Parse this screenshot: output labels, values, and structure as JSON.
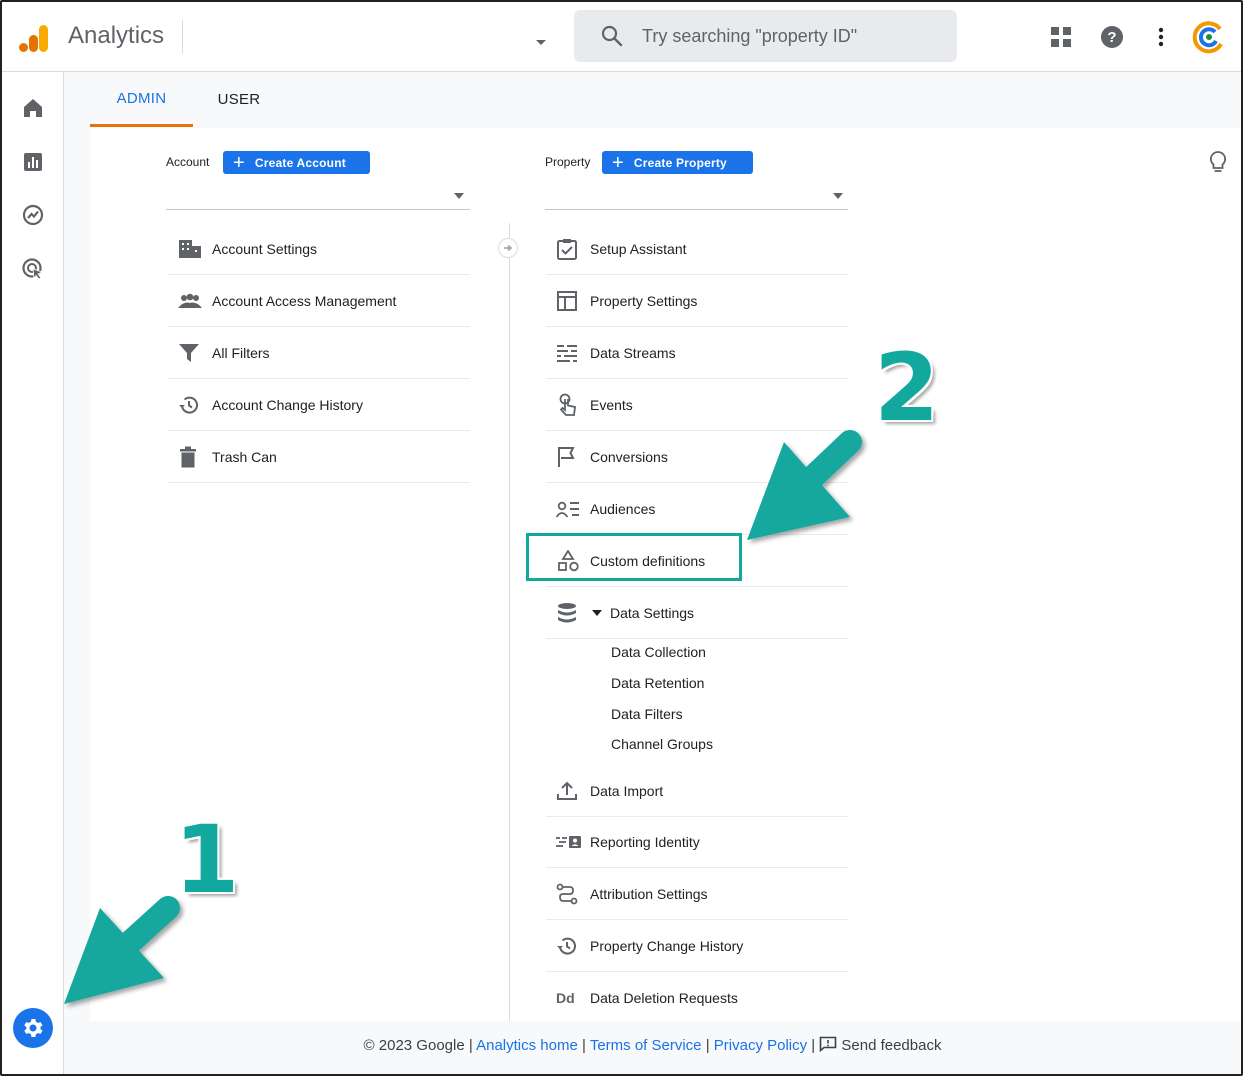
{
  "header": {
    "app_title": "Analytics",
    "search_placeholder": "Try searching \"property ID\""
  },
  "tabs": [
    {
      "label": "ADMIN",
      "active": true
    },
    {
      "label": "USER",
      "active": false
    }
  ],
  "account": {
    "label": "Account",
    "create_label": "Create Account",
    "items": [
      {
        "label": "Account Settings",
        "icon": "building-icon"
      },
      {
        "label": "Account Access Management",
        "icon": "people-icon"
      },
      {
        "label": "All Filters",
        "icon": "filter-icon"
      },
      {
        "label": "Account Change History",
        "icon": "history-icon"
      },
      {
        "label": "Trash Can",
        "icon": "trash-icon"
      }
    ]
  },
  "property": {
    "label": "Property",
    "create_label": "Create Property",
    "items": [
      {
        "label": "Setup Assistant",
        "icon": "checklist-icon"
      },
      {
        "label": "Property Settings",
        "icon": "layout-icon"
      },
      {
        "label": "Data Streams",
        "icon": "streams-icon"
      },
      {
        "label": "Events",
        "icon": "touch-icon"
      },
      {
        "label": "Conversions",
        "icon": "flag-icon"
      },
      {
        "label": "Audiences",
        "icon": "audience-icon"
      },
      {
        "label": "Custom definitions",
        "icon": "shapes-icon"
      },
      {
        "label": "Data Settings",
        "icon": "database-icon"
      }
    ],
    "data_settings_sub": [
      "Data Collection",
      "Data Retention",
      "Data Filters",
      "Channel Groups"
    ],
    "items_after": [
      {
        "label": "Data Import",
        "icon": "upload-icon"
      },
      {
        "label": "Reporting Identity",
        "icon": "identity-icon"
      },
      {
        "label": "Attribution Settings",
        "icon": "attribution-icon"
      },
      {
        "label": "Property Change History",
        "icon": "history-icon"
      },
      {
        "label": "Data Deletion Requests",
        "icon": "dd-icon",
        "icon_text": "Dd"
      }
    ]
  },
  "annotations": {
    "step1": "1",
    "step2": "2",
    "accent": "#13a89e"
  },
  "footer": {
    "copyright": "© 2023 Google",
    "analytics_home": "Analytics home",
    "terms": "Terms of Service",
    "privacy": "Privacy Policy",
    "feedback": "Send feedback",
    "separator": "|"
  },
  "colors": {
    "primary": "#1a73e8",
    "tab_underline": "#e8710a"
  }
}
